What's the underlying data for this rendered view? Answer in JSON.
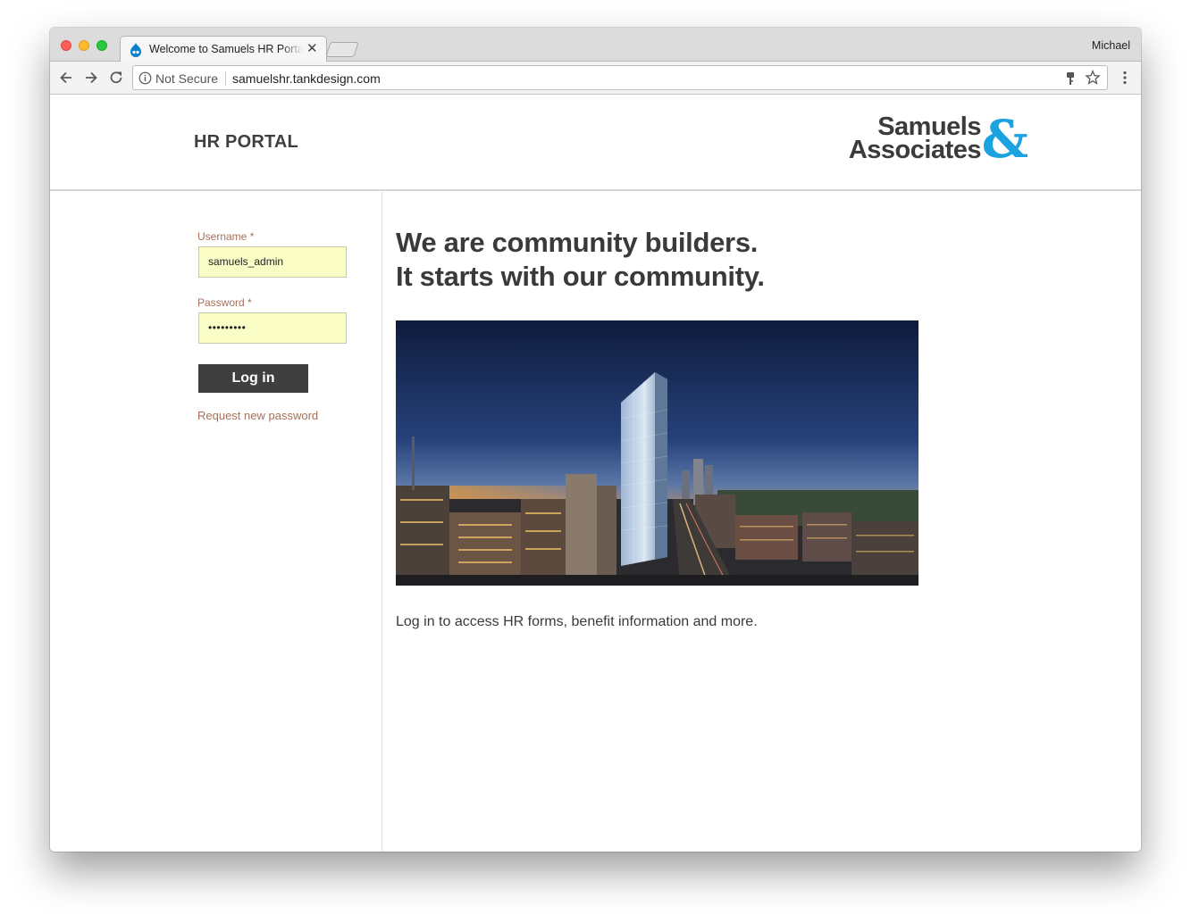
{
  "browser": {
    "tab_title": "Welcome to Samuels HR Portal",
    "tab_close": "✕",
    "profile_name": "Michael",
    "security_label": "Not Secure",
    "url": "samuelshr.tankdesign.com"
  },
  "header": {
    "site_title": "HR PORTAL",
    "logo": {
      "line1": "Samuels",
      "line2": "Associates",
      "ampersand": "&",
      "accent_color": "#1aa3e0"
    }
  },
  "login_form": {
    "username_label": "Username *",
    "username_value": "samuels_admin",
    "password_label": "Password *",
    "password_value": "•••••••••",
    "submit_label": "Log in",
    "reset_link": "Request new password"
  },
  "main": {
    "headline_line1": "We are community builders.",
    "headline_line2": "It starts with our community.",
    "intro": "Log in to access HR forms, benefit information and more."
  }
}
